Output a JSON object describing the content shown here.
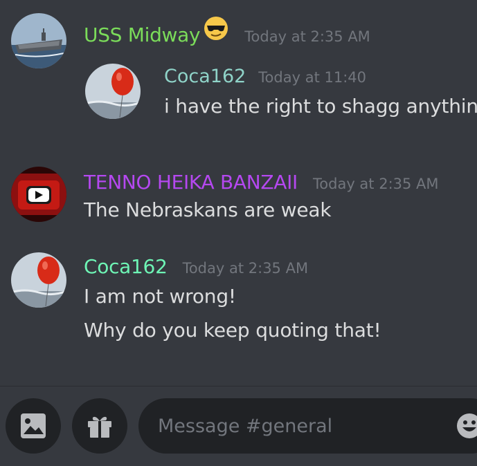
{
  "messages": [
    {
      "author": "USS Midway",
      "author_color": "#7bdc5a",
      "time": "Today at 2:35 AM",
      "avatar_icon": "aircraft-carrier-avatar",
      "emoji": "sunglasses-emoji",
      "quote": {
        "author": "Coca162",
        "time": "Today at 11:40",
        "text": "i have the right to shagg anything"
      }
    },
    {
      "author": "TENNO HEIKA BANZAII",
      "author_color": "#b548f0",
      "time": "Today at 2:35 AM",
      "avatar_icon": "youtube-play-avatar",
      "lines": [
        "The Nebraskans are weak"
      ]
    },
    {
      "author": "Coca162",
      "author_color": "#6ef5b5",
      "time": "Today at 2:35 AM",
      "avatar_icon": "red-balloon-avatar",
      "lines": [
        "I am not wrong!",
        "Why do you keep quoting that!"
      ]
    }
  ],
  "composer": {
    "image_icon": "image-icon",
    "gift_icon": "gift-icon",
    "placeholder": "Message #general",
    "emoji_icon": "emoji-icon"
  }
}
